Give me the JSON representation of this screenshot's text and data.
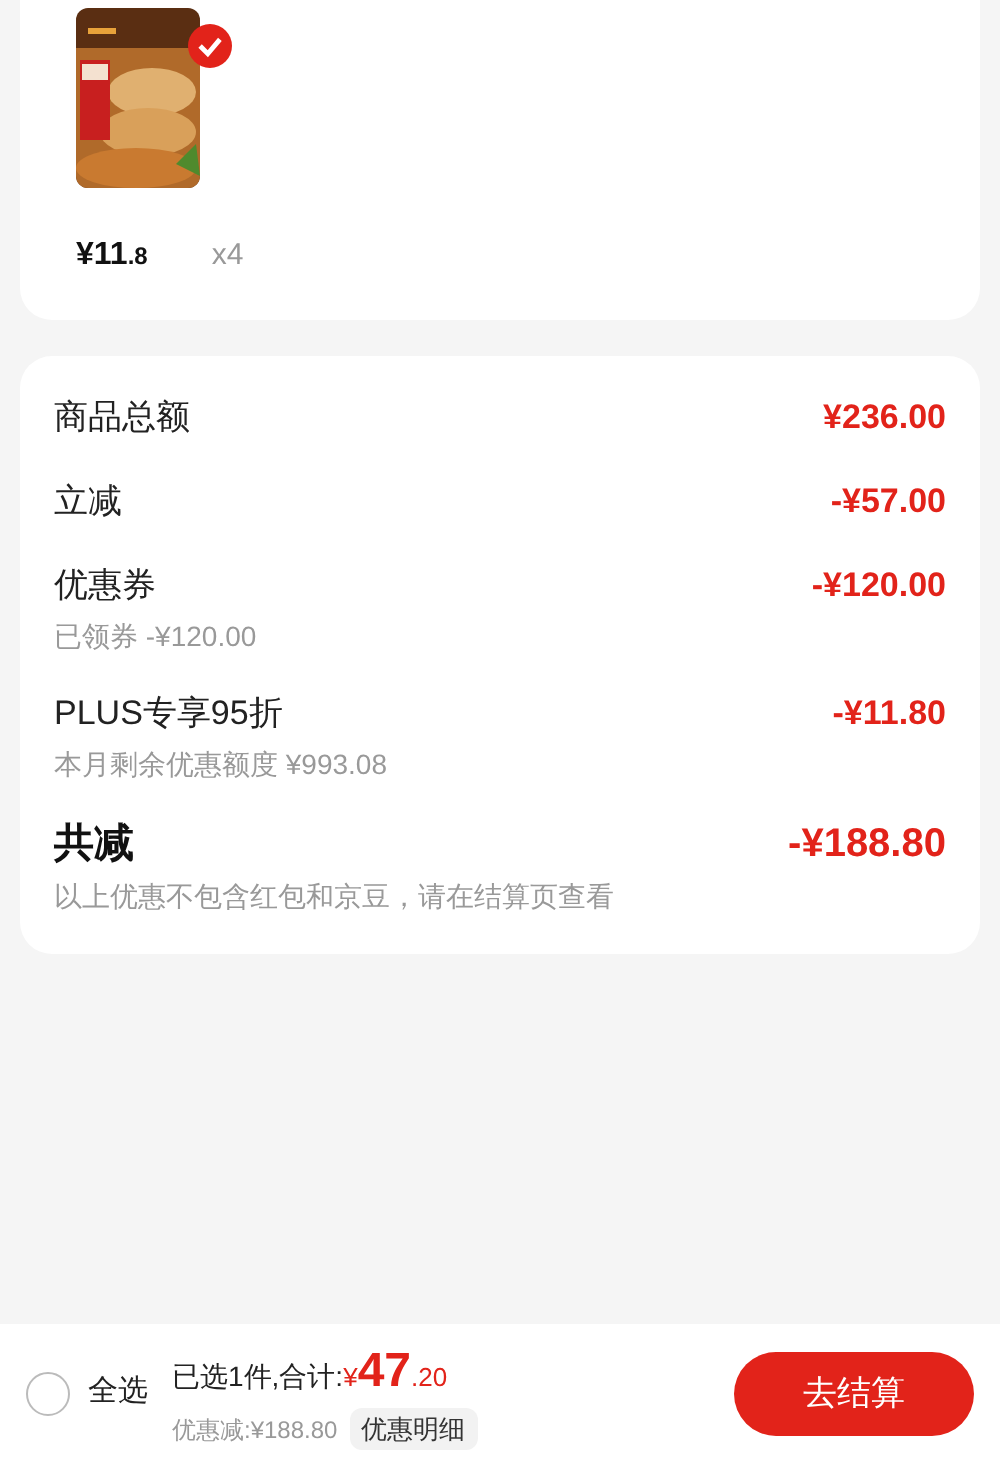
{
  "product": {
    "kind": "picture",
    "selected": true,
    "price_symbol": "¥",
    "price_int": "11",
    "price_dec": ".8",
    "quantity": "x4"
  },
  "summary": {
    "rows": [
      {
        "label": "商品总额",
        "amount": "¥236.00",
        "kind": "plain"
      },
      {
        "label": "立减",
        "amount": "-¥57.00",
        "kind": "plain"
      },
      {
        "label": "优惠券",
        "amount": "-¥120.00",
        "note": "已领券 -¥120.00",
        "kind": "plain"
      },
      {
        "label": "PLUS专享95折",
        "amount": "-¥11.80",
        "note": "本月剩余优惠额度 ¥993.08",
        "kind": "plain"
      },
      {
        "label": "共减",
        "amount": "-¥188.80",
        "note": "以上优惠不包含红包和京豆，请在结算页查看",
        "kind": "total"
      }
    ]
  },
  "footer": {
    "select_all": {
      "label": "全选",
      "checked": false
    },
    "selected_text": "已选1件,合计:",
    "total_symbol": "¥",
    "total_int": "47",
    "total_dec": ".20",
    "discount": "优惠减:¥188.80",
    "detail_button": "优惠明细",
    "checkout_button": "去结算"
  }
}
